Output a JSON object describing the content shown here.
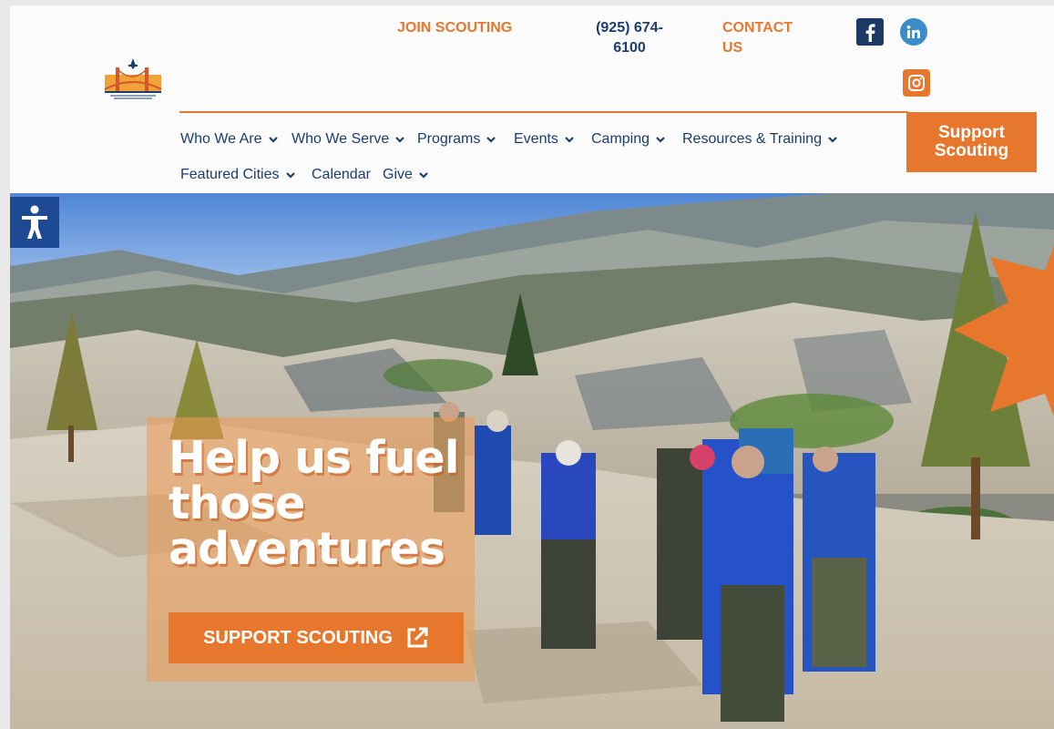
{
  "header": {
    "join_label": "JOIN SCOUTING",
    "phone": "(925) 674-\n6100",
    "contact_label": "CONTACT\nUS",
    "support_label": "Support\nScouting"
  },
  "nav": {
    "items": [
      {
        "label": "Who We Are"
      },
      {
        "label": "Who We Serve"
      },
      {
        "label": "Programs"
      },
      {
        "label": "Events"
      },
      {
        "label": "Camping"
      },
      {
        "label": "Resources & Training"
      },
      {
        "label": "Featured Cities"
      },
      {
        "label": "Calendar"
      },
      {
        "label": "Give"
      }
    ]
  },
  "hero": {
    "headline": "Help us fuel those adventures",
    "cta_label": "SUPPORT SCOUTING"
  },
  "colors": {
    "accent": "#e8772e",
    "navy": "#1a3e6f",
    "accessibility": "#1d4a92"
  },
  "icons": {
    "social": [
      "facebook-icon",
      "linkedin-icon",
      "instagram-icon"
    ],
    "accessibility": "accessibility-icon",
    "external": "external-link-icon"
  }
}
